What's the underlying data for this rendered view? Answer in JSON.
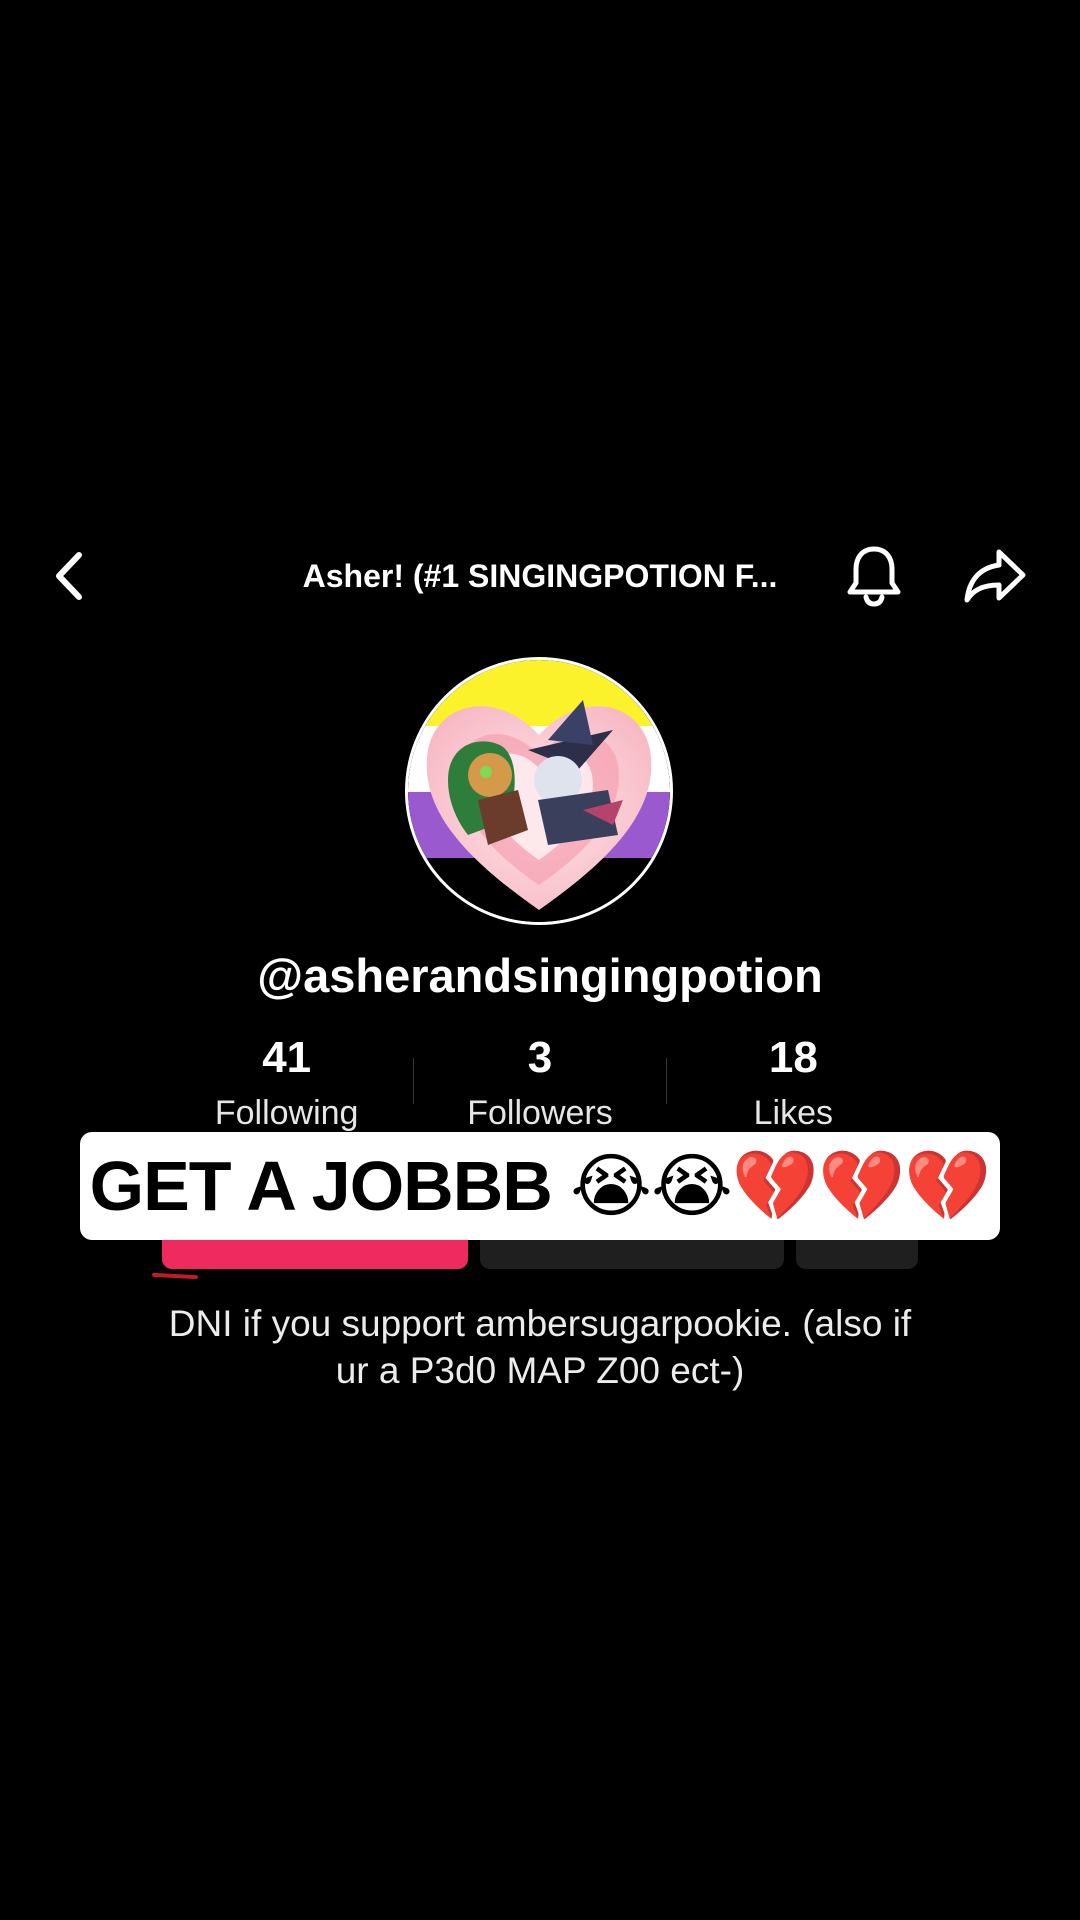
{
  "header": {
    "title": "Asher! (#1 SINGINGPOTION F...",
    "back_icon": "chevron-left-icon",
    "bell_icon": "bell-icon",
    "share_icon": "share-arrow-icon"
  },
  "profile": {
    "handle": "@asherandsingingpotion",
    "stats": [
      {
        "value": "41",
        "label": "Following"
      },
      {
        "value": "3",
        "label": "Followers"
      },
      {
        "value": "18",
        "label": "Likes"
      }
    ],
    "bio_line1": "DNI if you support ambersugarpookie. (also if",
    "bio_line2": "ur a P3d0 MAP Z00 ect-)"
  },
  "caption": {
    "text": "GET A JOBBB 😭😭💔💔💔"
  },
  "colors": {
    "background": "#000000",
    "follow_button": "#ef2a5f",
    "secondary_button": "#1f1f1f",
    "caption_background": "#ffffff"
  }
}
